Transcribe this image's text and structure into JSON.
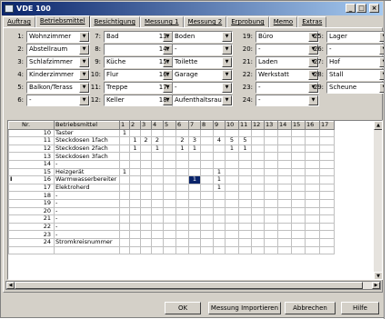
{
  "window": {
    "title": "VDE 100",
    "minimize": "_",
    "maximize": "□",
    "close": "×"
  },
  "tabs": [
    "Auftrag",
    "Betriebsmittel",
    "Besichtigung",
    "Messung 1",
    "Messung 2",
    "Erprobung",
    "Memo",
    "Extras"
  ],
  "active_tab": "Betriebsmittel",
  "rooms": [
    {
      "num": "1:",
      "value": "Wohnzimmer"
    },
    {
      "num": "2:",
      "value": "Abstellraum"
    },
    {
      "num": "3:",
      "value": "Schlafzimmer"
    },
    {
      "num": "4:",
      "value": "Kinderzimmer"
    },
    {
      "num": "5:",
      "value": "Balkon/Terass"
    },
    {
      "num": "6:",
      "value": "-"
    },
    {
      "num": "7:",
      "value": "Bad"
    },
    {
      "num": "8:",
      "value": ""
    },
    {
      "num": "9:",
      "value": "Küche"
    },
    {
      "num": "10:",
      "value": "Flur"
    },
    {
      "num": "11:",
      "value": "Treppe"
    },
    {
      "num": "12:",
      "value": "Keller"
    },
    {
      "num": "13:",
      "value": "Boden"
    },
    {
      "num": "14:",
      "value": "-"
    },
    {
      "num": "15:",
      "value": "Toilette"
    },
    {
      "num": "16:",
      "value": "Garage"
    },
    {
      "num": "17:",
      "value": "-"
    },
    {
      "num": "18:",
      "value": "Aufenthaltsrau"
    },
    {
      "num": "19:",
      "value": "Büro"
    },
    {
      "num": "20:",
      "value": "-"
    },
    {
      "num": "21:",
      "value": "Laden"
    },
    {
      "num": "22:",
      "value": "Werkstatt"
    },
    {
      "num": "23:",
      "value": "-"
    },
    {
      "num": "24:",
      "value": "-"
    },
    {
      "num": "25:",
      "value": "Lager"
    },
    {
      "num": "26:",
      "value": "-"
    },
    {
      "num": "27:",
      "value": "Hof"
    },
    {
      "num": "28:",
      "value": "Stall"
    },
    {
      "num": "29:",
      "value": "Scheune"
    }
  ],
  "grid": {
    "headers": [
      "Nr.",
      "Betriebsmittel",
      "1",
      "2",
      "3",
      "4",
      "5",
      "6",
      "7",
      "8",
      "9",
      "10",
      "11",
      "12",
      "13",
      "14",
      "15",
      "16",
      "17"
    ],
    "rows": [
      {
        "marker": "",
        "nr": "10",
        "name": "Taster",
        "cells": [
          "1",
          "",
          "",
          "",
          "",
          "",
          "",
          "",
          "",
          "",
          "",
          "",
          "",
          "",
          "",
          "",
          ""
        ]
      },
      {
        "marker": "",
        "nr": "11",
        "name": "Steckdosen 1fach",
        "cells": [
          "",
          "1",
          "2",
          "2",
          "",
          "2",
          "3",
          "",
          "4",
          "5",
          "5",
          "",
          "",
          "",
          "",
          "",
          ""
        ]
      },
      {
        "marker": "",
        "nr": "12",
        "name": "Steckdosen 2fach",
        "cells": [
          "",
          "1",
          "",
          "1",
          "",
          "1",
          "1",
          "",
          "",
          "1",
          "1",
          "",
          "",
          "",
          "",
          "",
          ""
        ]
      },
      {
        "marker": "",
        "nr": "13",
        "name": "Steckdosen 3fach",
        "cells": [
          "",
          "",
          "",
          "",
          "",
          "",
          "",
          "",
          "",
          "",
          "",
          "",
          "",
          "",
          "",
          "",
          ""
        ]
      },
      {
        "marker": "",
        "nr": "14",
        "name": "-",
        "cells": [
          "",
          "",
          "",
          "",
          "",
          "",
          "",
          "",
          "",
          "",
          "",
          "",
          "",
          "",
          "",
          "",
          ""
        ]
      },
      {
        "marker": "",
        "nr": "15",
        "name": "Heizgerät",
        "cells": [
          "1",
          "",
          "",
          "",
          "",
          "",
          "",
          "",
          "1",
          "",
          "",
          "",
          "",
          "",
          "",
          "",
          ""
        ]
      },
      {
        "marker": "I",
        "nr": "16",
        "name": "Warmwasserbereiter",
        "cells": [
          "",
          "",
          "",
          "",
          "",
          "",
          "1",
          "",
          "1",
          "",
          "",
          "",
          "",
          "",
          "",
          "",
          ""
        ]
      },
      {
        "marker": "",
        "nr": "17",
        "name": "Elektroherd",
        "cells": [
          "",
          "",
          "",
          "",
          "",
          "",
          "",
          "",
          "1",
          "",
          "",
          "",
          "",
          "",
          "",
          "",
          ""
        ]
      },
      {
        "marker": "",
        "nr": "18",
        "name": "-",
        "cells": [
          "",
          "",
          "",
          "",
          "",
          "",
          "",
          "",
          "",
          "",
          "",
          "",
          "",
          "",
          "",
          "",
          ""
        ]
      },
      {
        "marker": "",
        "nr": "19",
        "name": "-",
        "cells": [
          "",
          "",
          "",
          "",
          "",
          "",
          "",
          "",
          "",
          "",
          "",
          "",
          "",
          "",
          "",
          "",
          ""
        ]
      },
      {
        "marker": "",
        "nr": "20",
        "name": "-",
        "cells": [
          "",
          "",
          "",
          "",
          "",
          "",
          "",
          "",
          "",
          "",
          "",
          "",
          "",
          "",
          "",
          "",
          ""
        ]
      },
      {
        "marker": "",
        "nr": "21",
        "name": "-",
        "cells": [
          "",
          "",
          "",
          "",
          "",
          "",
          "",
          "",
          "",
          "",
          "",
          "",
          "",
          "",
          "",
          "",
          ""
        ]
      },
      {
        "marker": "",
        "nr": "22",
        "name": "-",
        "cells": [
          "",
          "",
          "",
          "",
          "",
          "",
          "",
          "",
          "",
          "",
          "",
          "",
          "",
          "",
          "",
          "",
          ""
        ]
      },
      {
        "marker": "",
        "nr": "23",
        "name": "-",
        "cells": [
          "",
          "",
          "",
          "",
          "",
          "",
          "",
          "",
          "",
          "",
          "",
          "",
          "",
          "",
          "",
          "",
          ""
        ]
      },
      {
        "marker": "",
        "nr": "24",
        "name": "Stromkreisnummer",
        "cells": [
          "",
          "",
          "",
          "",
          "",
          "",
          "",
          "",
          "",
          "",
          "",
          "",
          "",
          "",
          "",
          "",
          ""
        ]
      },
      {
        "marker": "",
        "nr": "",
        "name": "",
        "cells": [
          "",
          "",
          "",
          "",
          "",
          "",
          "",
          "",
          "",
          "",
          "",
          "",
          "",
          "",
          "",
          "",
          ""
        ]
      }
    ]
  },
  "buttons": {
    "ok": "OK",
    "import": "Messung Importieren",
    "cancel": "Abbrechen",
    "help": "Hilfe"
  }
}
